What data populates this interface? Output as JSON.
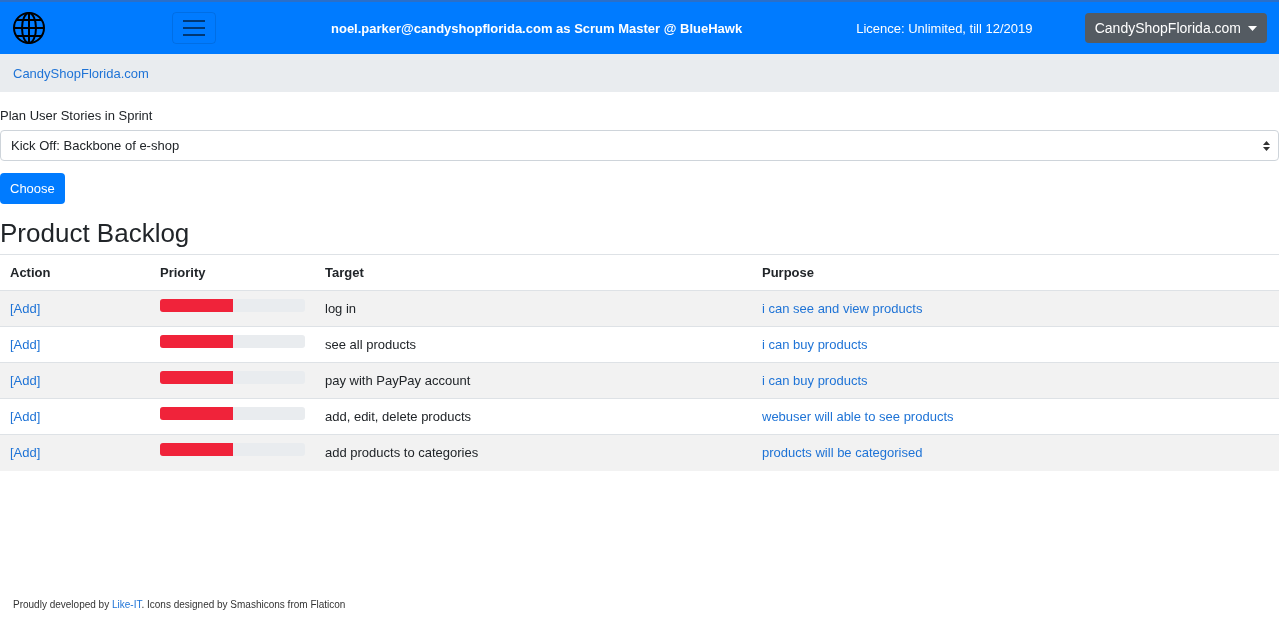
{
  "navbar": {
    "user_text": "noel.parker@candyshopflorida.com as Scrum Master @ BlueHawk",
    "licence": "Licence: Unlimited, till 12/2019",
    "company_menu": "CandyShopFlorida.com"
  },
  "breadcrumb": [
    "CandyShopFlorida.com"
  ],
  "sprint_form": {
    "label": "Plan User Stories in Sprint",
    "value": "Kick Off: Backbone of e-shop",
    "button": "Choose"
  },
  "heading": "Product Backlog",
  "table": {
    "columns": [
      "Action",
      "Priority",
      "Target",
      "Purpose"
    ],
    "rows": [
      {
        "action": "[Add]",
        "level": 0.5,
        "target": "log in",
        "purpose": "i can see and view products"
      },
      {
        "action": "[Add]",
        "level": 0.5,
        "target": "see all products",
        "purpose": "i can buy products"
      },
      {
        "action": "[Add]",
        "level": 0.5,
        "target": "pay with PayPay account",
        "purpose": "i can buy products"
      },
      {
        "action": "[Add]",
        "level": 0.5,
        "target": "add, edit, delete products",
        "purpose": "webuser will able to see products"
      },
      {
        "action": "[Add]",
        "level": 0.5,
        "target": "add products to categories",
        "purpose": "products will be categorised"
      }
    ]
  },
  "footer": {
    "before": "Proudly developed by ",
    "link": "Like-IT",
    "after": ". Icons designed by Smashicons from Flaticon"
  }
}
